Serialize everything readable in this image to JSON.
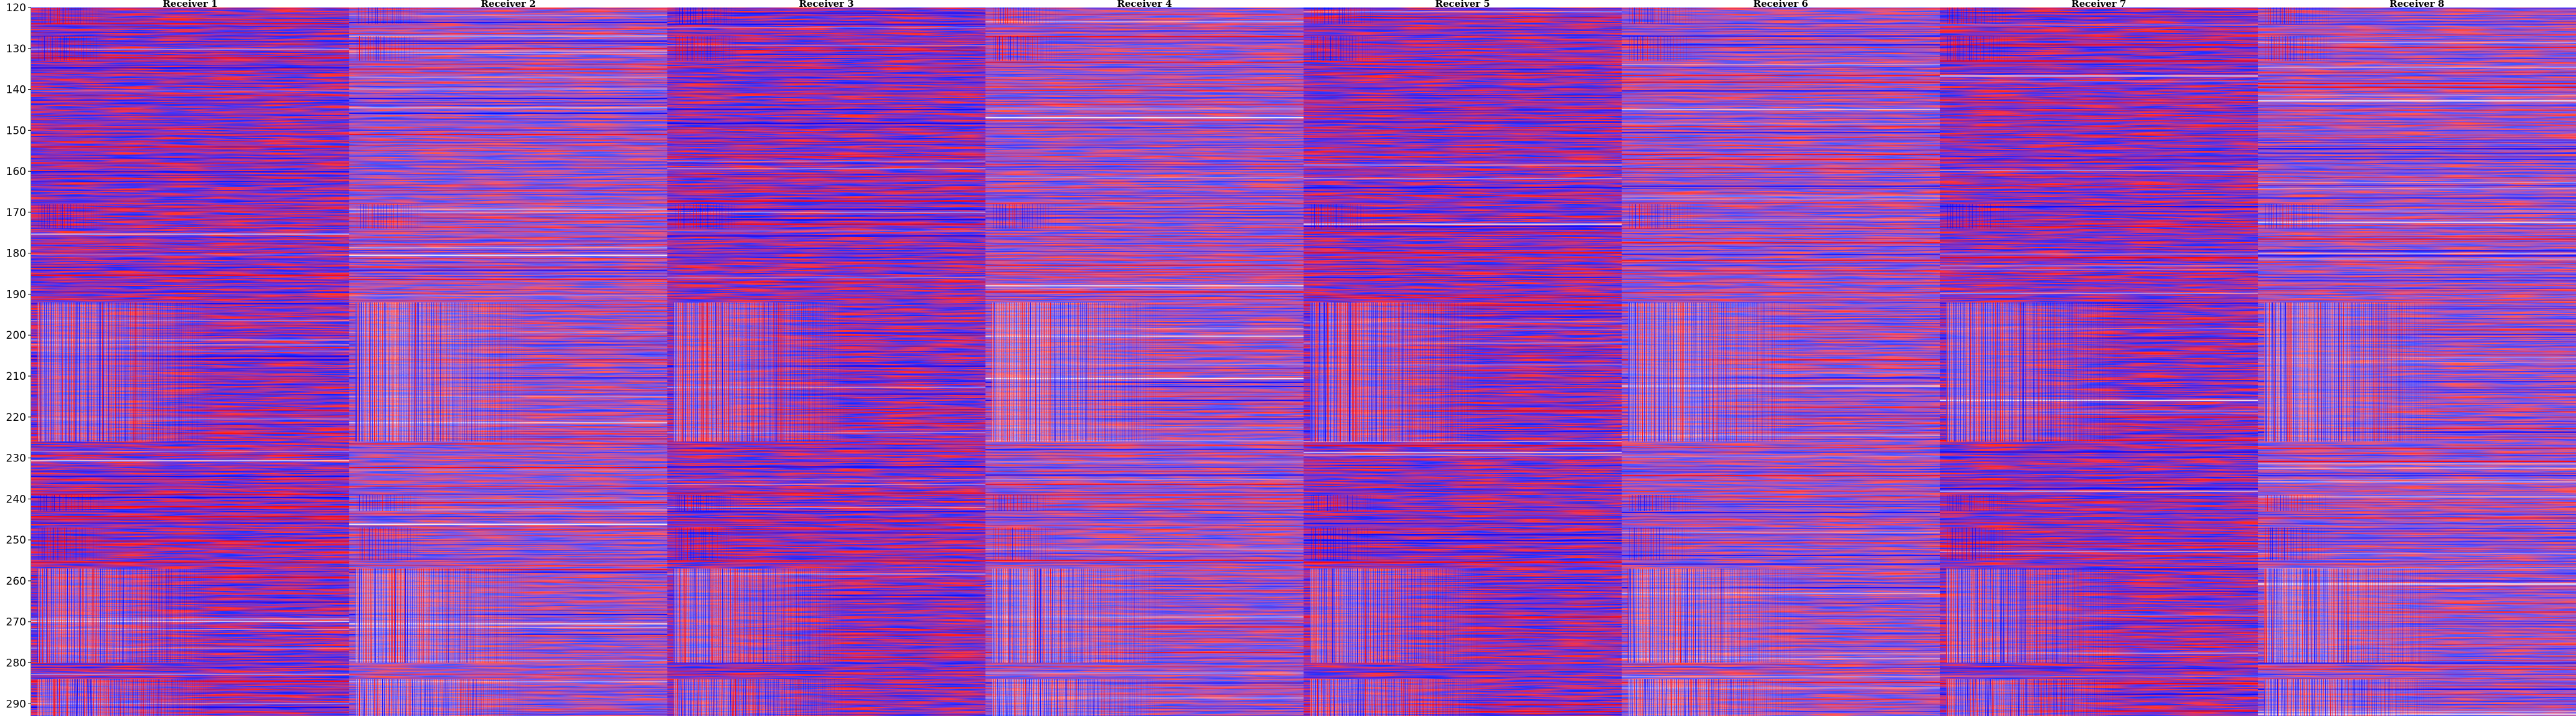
{
  "chart_data": {
    "type": "heatmap",
    "title": "",
    "xlabel": "",
    "ylabel": "",
    "panels": [
      {
        "title": "Receiver 1"
      },
      {
        "title": "Receiver 2"
      },
      {
        "title": "Receiver 3"
      },
      {
        "title": "Receiver 4"
      },
      {
        "title": "Receiver 5"
      },
      {
        "title": "Receiver 6"
      },
      {
        "title": "Receiver 7"
      },
      {
        "title": "Receiver 8"
      }
    ],
    "ylim": [
      120,
      293
    ],
    "y_inverted": true,
    "yticks": [
      120,
      130,
      140,
      150,
      160,
      170,
      180,
      190,
      200,
      210,
      220,
      230,
      240,
      250,
      260,
      270,
      280,
      290
    ],
    "colormap": [
      "#0000ff",
      "#ffffff",
      "#ff0000"
    ],
    "grid": false,
    "legend": "none",
    "strong_activity_bands": [
      {
        "from": 192,
        "to": 226
      },
      {
        "from": 257,
        "to": 280
      },
      {
        "from": 284,
        "to": 293
      }
    ],
    "weak_activity_bands": [
      {
        "from": 120,
        "to": 124
      },
      {
        "from": 127,
        "to": 133
      },
      {
        "from": 168,
        "to": 174
      },
      {
        "from": 239,
        "to": 243
      },
      {
        "from": 247,
        "to": 255
      }
    ]
  }
}
